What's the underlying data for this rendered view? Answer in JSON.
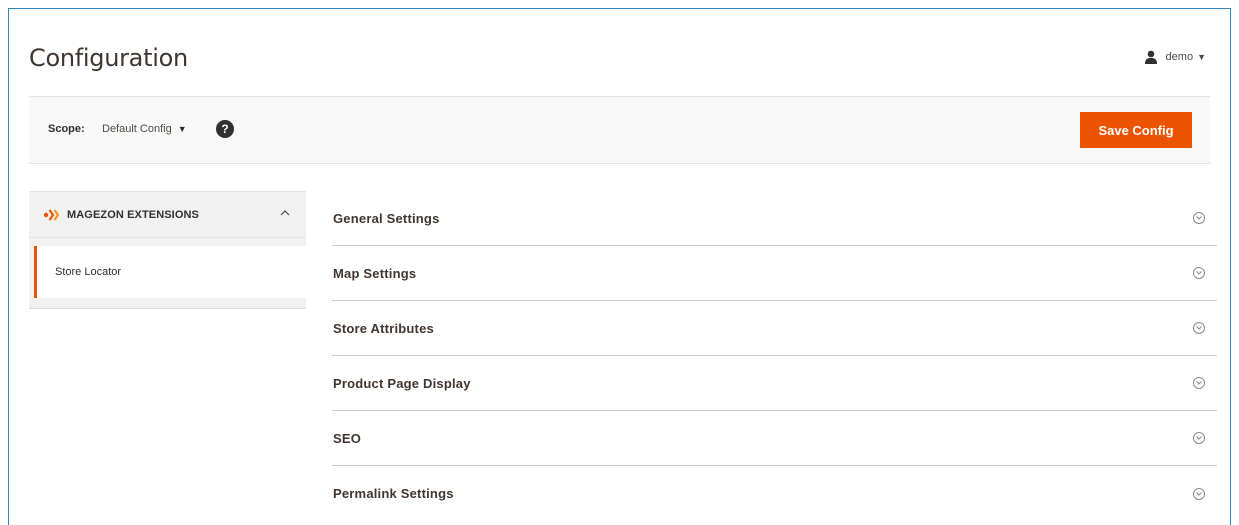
{
  "header": {
    "page_title": "Configuration",
    "user": {
      "name": "demo",
      "icon": "user-icon"
    }
  },
  "scope_bar": {
    "scope_label": "Scope:",
    "scope_value": "Default Config",
    "help_icon": "?",
    "save_label": "Save Config"
  },
  "sidebar": {
    "group_title": "MAGEZON EXTENSIONS",
    "group_chevron": "^",
    "items": [
      {
        "label": "Store Locator",
        "active": true
      }
    ]
  },
  "sections": [
    {
      "label": "General Settings"
    },
    {
      "label": "Map Settings"
    },
    {
      "label": "Store Attributes"
    },
    {
      "label": "Product Page Display"
    },
    {
      "label": "SEO"
    },
    {
      "label": "Permalink Settings"
    }
  ],
  "colors": {
    "accent": "#eb5202",
    "frame_border": "#2e86c1",
    "text": "#303030"
  }
}
